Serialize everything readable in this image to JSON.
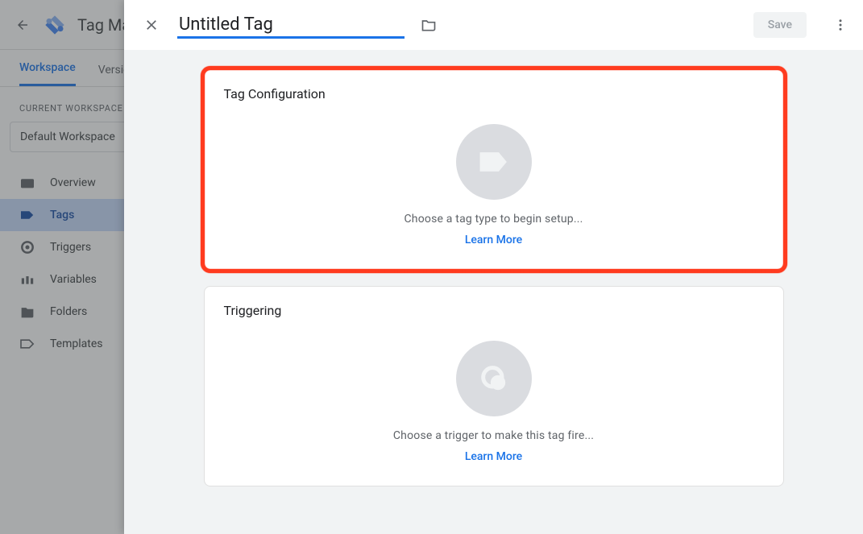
{
  "app": {
    "title": "Tag Manager",
    "tabs": [
      "Workspace",
      "Versions"
    ],
    "active_tab": "Workspace",
    "workspace_label": "CURRENT WORKSPACE",
    "workspace_name": "Default Workspace",
    "nav": [
      {
        "label": "Overview",
        "icon": "overview"
      },
      {
        "label": "Tags",
        "icon": "tag",
        "active": true
      },
      {
        "label": "Triggers",
        "icon": "trigger"
      },
      {
        "label": "Variables",
        "icon": "variables"
      },
      {
        "label": "Folders",
        "icon": "folder"
      },
      {
        "label": "Templates",
        "icon": "template"
      }
    ]
  },
  "modal": {
    "title": "Untitled Tag",
    "save_label": "Save",
    "cards": {
      "config": {
        "title": "Tag Configuration",
        "placeholder": "Choose a tag type to begin setup...",
        "learn": "Learn More"
      },
      "trigger": {
        "title": "Triggering",
        "placeholder": "Choose a trigger to make this tag fire...",
        "learn": "Learn More"
      }
    }
  }
}
